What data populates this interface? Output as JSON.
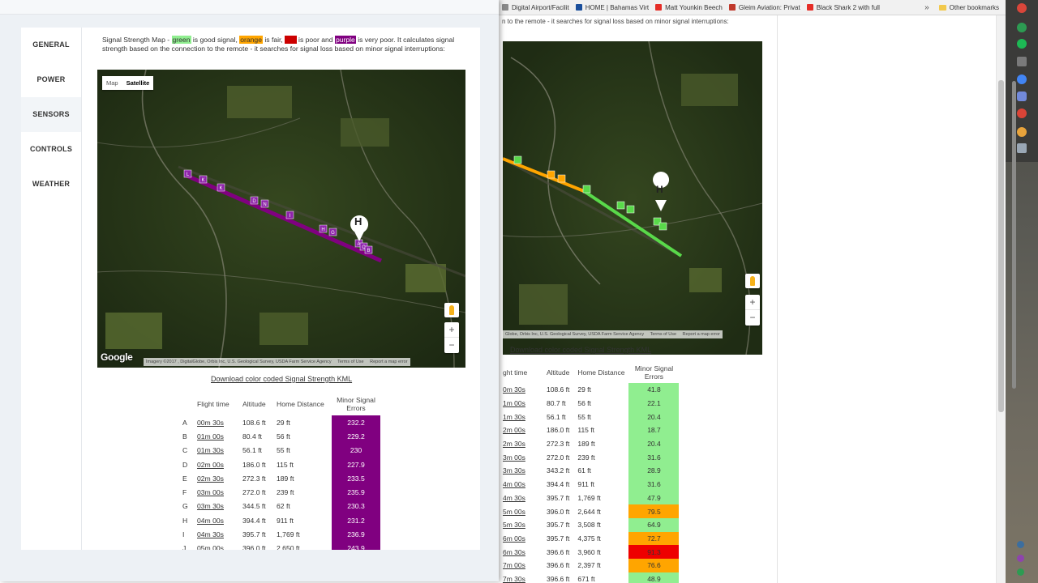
{
  "bookmarks": [
    {
      "label": "Digital Airport/Facilit",
      "icon": "page-icon",
      "color": "#8a8a8a"
    },
    {
      "label": "HOME | Bahamas Virt",
      "icon": "bahamas-icon",
      "color": "#1b4f9c"
    },
    {
      "label": "Matt Younkin Beech",
      "icon": "youtube-icon",
      "color": "#e52d27"
    },
    {
      "label": "Gleim Aviation: Privat",
      "icon": "gleim-icon",
      "color": "#c0392b"
    },
    {
      "label": "Black Shark 2 with full",
      "icon": "youtube-icon",
      "color": "#e52d27"
    }
  ],
  "bookmarks_overflow": "»",
  "other_bookmarks": "Other bookmarks",
  "nav": {
    "items": [
      "GENERAL",
      "POWER",
      "SENSORS",
      "CONTROLS",
      "WEATHER"
    ],
    "active": "SENSORS"
  },
  "intro": {
    "p1": "Signal Strength Map - ",
    "green": "green",
    "p2": " is good signal, ",
    "orange": "orange",
    "p3": " is fair, ",
    "red": "red",
    "p4": " is poor and ",
    "purple": "purple",
    "p5": " is very poor. It calculates signal strength based on the connection to the remote - it searches for signal loss based on minor signal interruptions:"
  },
  "map": {
    "map_btn": "Map",
    "satellite_btn": "Satellite",
    "home_marker": "H",
    "zoom_in": "+",
    "zoom_out": "−",
    "google": "Google",
    "attribution": "Imagery ©2017 , DigitalGlobe, Orbis Inc, U.S. Geological Survey, USDA Farm Service Agency",
    "terms": "Terms of Use",
    "report": "Report a map error",
    "bg_attribution": "Globe, Orbis Inc, U.S. Geological Survey, USDA Farm Service Agency"
  },
  "download_link": "Download color coded Signal Strength KML",
  "table": {
    "headers": {
      "time": "Flight time",
      "alt": "Altitude",
      "dist": "Home Distance",
      "err": "Minor Signal Errors"
    },
    "rows": [
      {
        "label": "A",
        "time": "00m 30s",
        "alt": "108.6 ft",
        "dist": "29 ft",
        "err": "232.2"
      },
      {
        "label": "B",
        "time": "01m 00s",
        "alt": "80.4 ft",
        "dist": "56 ft",
        "err": "229.2"
      },
      {
        "label": "C",
        "time": "01m 30s",
        "alt": "56.1 ft",
        "dist": "55 ft",
        "err": "230"
      },
      {
        "label": "D",
        "time": "02m 00s",
        "alt": "186.0 ft",
        "dist": "115 ft",
        "err": "227.9"
      },
      {
        "label": "E",
        "time": "02m 30s",
        "alt": "272.3 ft",
        "dist": "189 ft",
        "err": "233.5"
      },
      {
        "label": "F",
        "time": "03m 00s",
        "alt": "272.0 ft",
        "dist": "239 ft",
        "err": "235.9"
      },
      {
        "label": "G",
        "time": "03m 30s",
        "alt": "344.5 ft",
        "dist": "62 ft",
        "err": "230.3"
      },
      {
        "label": "H",
        "time": "04m 00s",
        "alt": "394.4 ft",
        "dist": "911 ft",
        "err": "231.2"
      },
      {
        "label": "I",
        "time": "04m 30s",
        "alt": "395.7 ft",
        "dist": "1,769 ft",
        "err": "236.9"
      },
      {
        "label": "J",
        "time": "05m 00s",
        "alt": "396.0 ft",
        "dist": "2,650 ft",
        "err": "243.9"
      }
    ]
  },
  "bg_intro": "n to the remote - it searches for signal loss based on minor signal interruptions:",
  "bg_table": {
    "headers": {
      "time": "ght time",
      "alt": "Altitude",
      "dist": "Home Distance",
      "err": "Minor Signal Errors"
    },
    "rows": [
      {
        "time": "0m 30s",
        "alt": "108.6 ft",
        "dist": "29 ft",
        "err": "41.8",
        "level": "green"
      },
      {
        "time": "1m 00s",
        "alt": "80.7 ft",
        "dist": "56 ft",
        "err": "22.1",
        "level": "green"
      },
      {
        "time": "1m 30s",
        "alt": "56.1 ft",
        "dist": "55 ft",
        "err": "20.4",
        "level": "green"
      },
      {
        "time": "2m 00s",
        "alt": "186.0 ft",
        "dist": "115 ft",
        "err": "18.7",
        "level": "green"
      },
      {
        "time": "2m 30s",
        "alt": "272.3 ft",
        "dist": "189 ft",
        "err": "20.4",
        "level": "green"
      },
      {
        "time": "3m 00s",
        "alt": "272.0 ft",
        "dist": "239 ft",
        "err": "31.6",
        "level": "green"
      },
      {
        "time": "3m 30s",
        "alt": "343.2 ft",
        "dist": "61 ft",
        "err": "28.9",
        "level": "green"
      },
      {
        "time": "4m 00s",
        "alt": "394.4 ft",
        "dist": "911 ft",
        "err": "31.6",
        "level": "green"
      },
      {
        "time": "4m 30s",
        "alt": "395.7 ft",
        "dist": "1,769 ft",
        "err": "47.9",
        "level": "green"
      },
      {
        "time": "5m 00s",
        "alt": "396.0 ft",
        "dist": "2,644 ft",
        "err": "79.5",
        "level": "orange"
      },
      {
        "time": "5m 30s",
        "alt": "395.7 ft",
        "dist": "3,508 ft",
        "err": "64.9",
        "level": "green"
      },
      {
        "time": "6m 00s",
        "alt": "395.7 ft",
        "dist": "4,375 ft",
        "err": "72.7",
        "level": "orange"
      },
      {
        "time": "6m 30s",
        "alt": "396.6 ft",
        "dist": "3,960 ft",
        "err": "91.3",
        "level": "red"
      },
      {
        "time": "7m 00s",
        "alt": "396.6 ft",
        "dist": "2,397 ft",
        "err": "76.6",
        "level": "orange"
      },
      {
        "time": "7m 30s",
        "alt": "396.6 ft",
        "dist": "671 ft",
        "err": "48.9",
        "level": "green"
      }
    ]
  },
  "colors": {
    "green": "#90ee90",
    "orange": "#ffa500",
    "red": "#ee0000",
    "purple": "#800080"
  }
}
